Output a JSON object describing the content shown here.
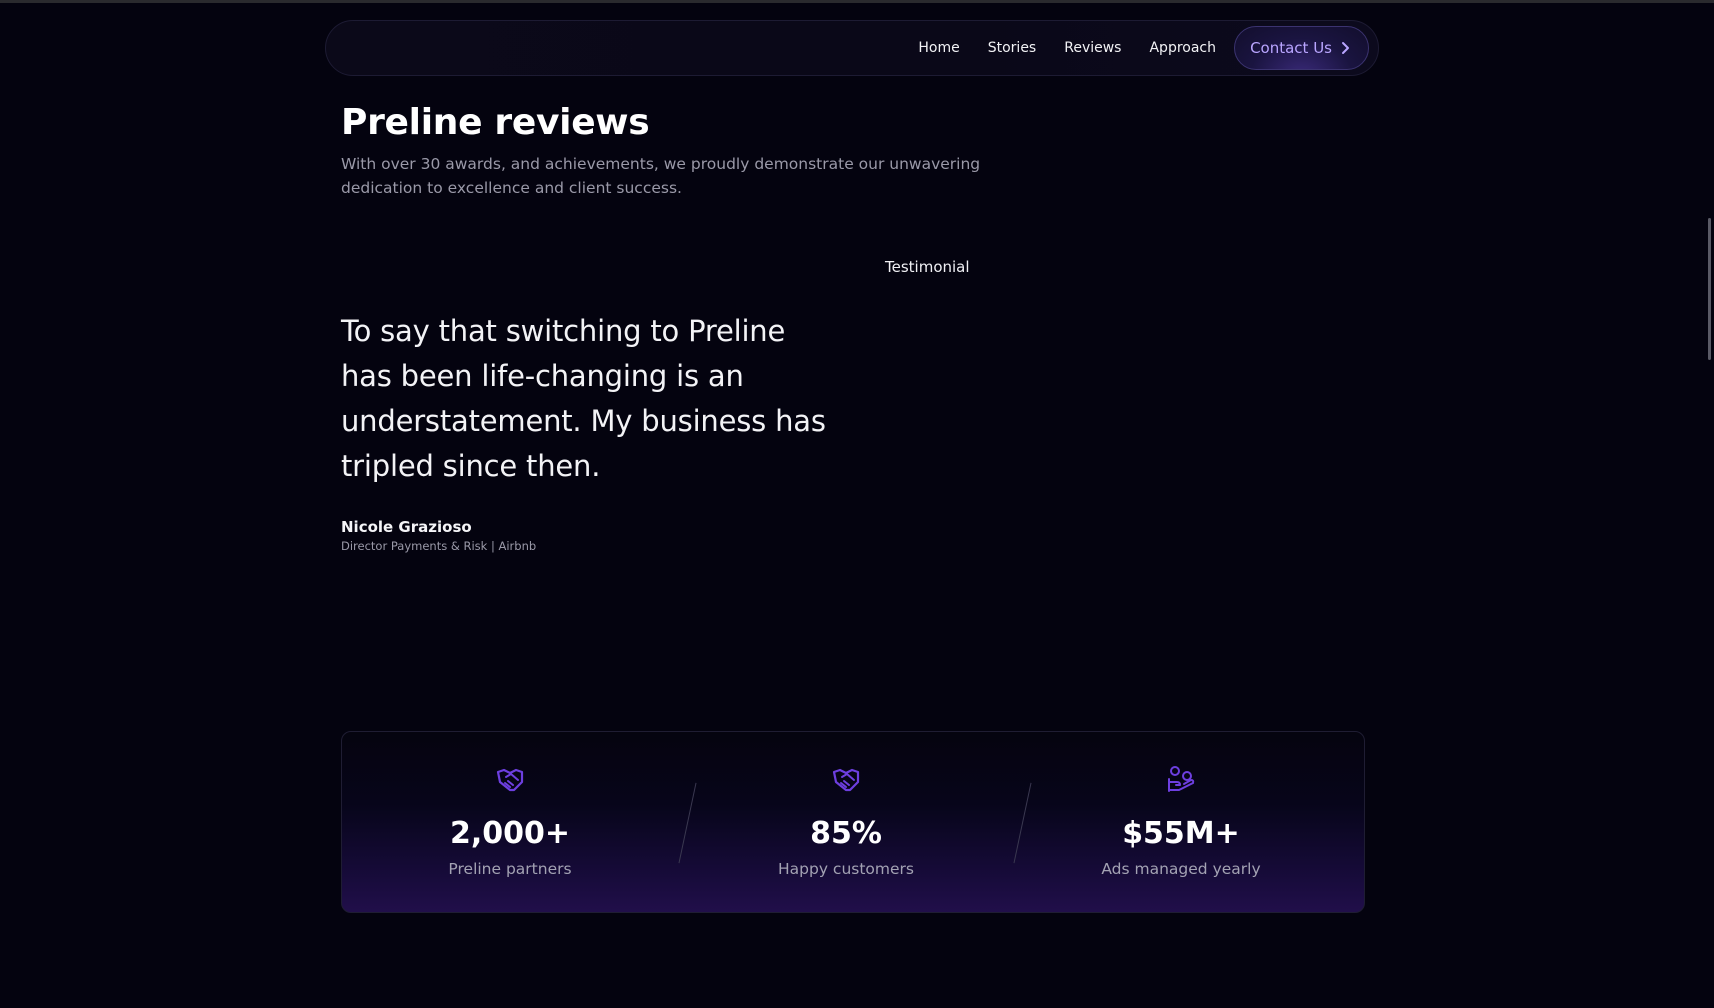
{
  "nav": {
    "links": [
      "Home",
      "Stories",
      "Reviews",
      "Approach"
    ],
    "cta_label": "Contact Us",
    "cta_icon": "chevron-right-icon"
  },
  "section": {
    "title": "Preline reviews",
    "subtitle": "With over 30 awards, and achievements, we proudly demonstrate our unwavering dedication to excellence and client success.",
    "testimonial_label": "Testimonial"
  },
  "testimonial": {
    "quote": "To say that switching to Preline has been life-changing is an understatement. My business has tripled since then.",
    "author_name": "Nicole Grazioso",
    "author_role": "Director Payments & Risk | Airbnb"
  },
  "stats": [
    {
      "icon": "handshake-icon",
      "value": "2,000+",
      "label": "Preline partners"
    },
    {
      "icon": "handshake-icon",
      "value": "85%",
      "label": "Happy customers"
    },
    {
      "icon": "hand-coins-icon",
      "value": "$55M+",
      "label": "Ads managed yearly"
    }
  ],
  "colors": {
    "background": "#04030f",
    "accent": "#7c5cff",
    "cta_text": "#b9a5ff"
  }
}
